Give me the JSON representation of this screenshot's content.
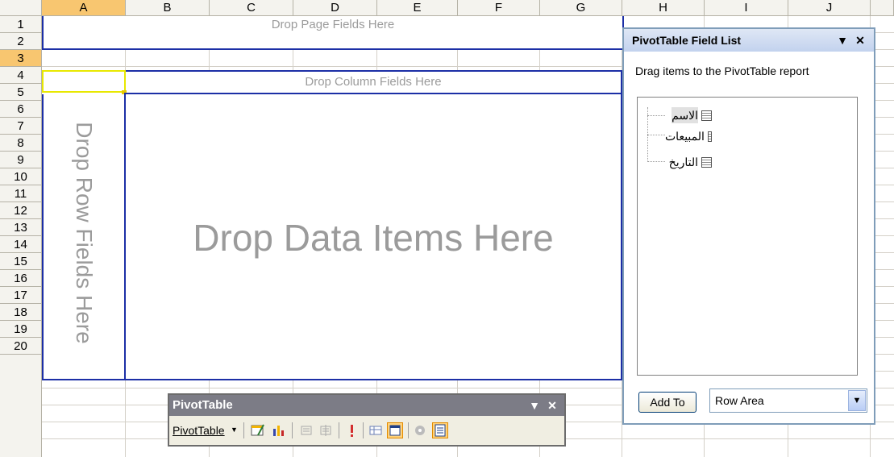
{
  "columns": [
    "A",
    "B",
    "C",
    "D",
    "E",
    "F",
    "G",
    "H",
    "I",
    "J"
  ],
  "rows": [
    "1",
    "2",
    "3",
    "4",
    "5",
    "6",
    "7",
    "8",
    "9",
    "10",
    "11",
    "12",
    "13",
    "14",
    "15",
    "16",
    "17",
    "18",
    "19",
    "20"
  ],
  "selected_column": "A",
  "selected_row": "3",
  "drop_zones": {
    "page": "Drop Page Fields Here",
    "column": "Drop Column Fields Here",
    "row": "Drop Row Fields Here",
    "data": "Drop Data Items Here"
  },
  "field_list": {
    "title": "PivotTable Field List",
    "instructions": "Drag items to the PivotTable report",
    "fields": [
      "الاسم",
      "المبيعات",
      "التاريخ"
    ],
    "add_to_label": "Add To",
    "area_value": "Row Area"
  },
  "toolbar": {
    "title": "PivotTable",
    "menu_label": "PivotTable",
    "menu_mnemonic": "P"
  },
  "colors": {
    "drop_border": "#1c2fa6",
    "header_selected": "#f8c670",
    "hint_text": "#9b9b9b"
  }
}
